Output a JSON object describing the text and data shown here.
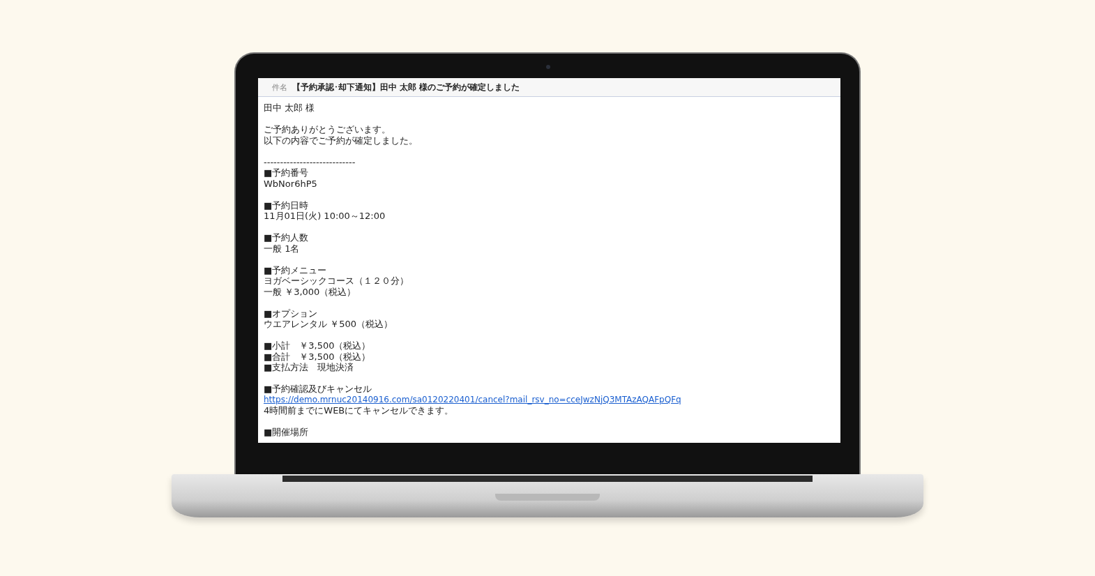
{
  "email": {
    "subject_label": "件名",
    "subject": "【予約承認･却下通知】田中 太郎 様のご予約が確定しました",
    "lines": [
      {
        "kind": "text",
        "text": "田中 太郎 様"
      },
      {
        "kind": "blank"
      },
      {
        "kind": "text",
        "text": "ご予約ありがとうございます。"
      },
      {
        "kind": "text",
        "text": "以下の内容でご予約が確定しました。"
      },
      {
        "kind": "blank"
      },
      {
        "kind": "text",
        "text": "----------------------------"
      },
      {
        "kind": "text",
        "text": "■予約番号"
      },
      {
        "kind": "text",
        "text": "WbNor6hP5"
      },
      {
        "kind": "blank"
      },
      {
        "kind": "text",
        "text": "■予約日時"
      },
      {
        "kind": "text",
        "text": "11月01日(火) 10:00～12:00"
      },
      {
        "kind": "blank"
      },
      {
        "kind": "text",
        "text": "■予約人数"
      },
      {
        "kind": "text",
        "text": "一般 1名"
      },
      {
        "kind": "blank"
      },
      {
        "kind": "text",
        "text": "■予約メニュー"
      },
      {
        "kind": "text",
        "text": "ヨガベーシックコース（１２０分）"
      },
      {
        "kind": "text",
        "text": "一般 ￥3,000（税込）"
      },
      {
        "kind": "blank"
      },
      {
        "kind": "text",
        "text": "■オプション"
      },
      {
        "kind": "text",
        "text": "ウエアレンタル ￥500（税込）"
      },
      {
        "kind": "blank"
      },
      {
        "kind": "text",
        "text": "■小計　￥3,500（税込）"
      },
      {
        "kind": "text",
        "text": "■合計　￥3,500（税込）"
      },
      {
        "kind": "text",
        "text": "■支払方法　現地決済"
      },
      {
        "kind": "blank"
      },
      {
        "kind": "text",
        "text": "■予約確認及びキャンセル"
      },
      {
        "kind": "link",
        "text": "https://demo.mrnuc20140916.com/sa0120220401/cancel?mail_rsv_no=cceJwzNjQ3MTAzAQAFpQFq"
      },
      {
        "kind": "text",
        "text": "4時間前までにWEBにてキャンセルできます。"
      },
      {
        "kind": "blank"
      },
      {
        "kind": "text",
        "text": "■開催場所"
      }
    ]
  }
}
